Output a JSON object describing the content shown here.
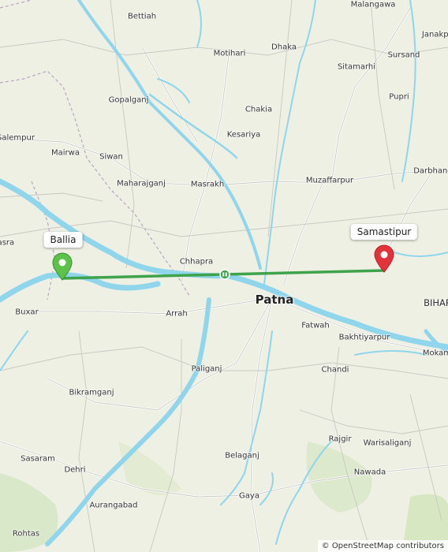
{
  "route": {
    "color": "#3ea34b",
    "from_label": "Ballia",
    "to_label": "Samastipur"
  },
  "markers": {
    "start": {
      "name": "Ballia",
      "color": "#5cc24a"
    },
    "end": {
      "name": "Samastipur",
      "color": "#e2323a"
    }
  },
  "places": [
    {
      "name": "Malangawa",
      "cls": ""
    },
    {
      "name": "Bettiah",
      "cls": ""
    },
    {
      "name": "Janakpur",
      "cls": ""
    },
    {
      "name": "Dhaka",
      "cls": ""
    },
    {
      "name": "Motihari",
      "cls": ""
    },
    {
      "name": "Sursand",
      "cls": ""
    },
    {
      "name": "Sitamarhi",
      "cls": ""
    },
    {
      "name": "Gopalganj",
      "cls": ""
    },
    {
      "name": "Pupri",
      "cls": ""
    },
    {
      "name": "Chakia",
      "cls": ""
    },
    {
      "name": "Salempur",
      "cls": ""
    },
    {
      "name": "Kesariya",
      "cls": ""
    },
    {
      "name": "Mairwa",
      "cls": ""
    },
    {
      "name": "Siwan",
      "cls": ""
    },
    {
      "name": "Darbhanga",
      "cls": ""
    },
    {
      "name": "Maharajganj",
      "cls": ""
    },
    {
      "name": "Masrakh",
      "cls": ""
    },
    {
      "name": "Muzaffarpur",
      "cls": ""
    },
    {
      "name": "Rasra",
      "cls": ""
    },
    {
      "name": "Chhapra",
      "cls": ""
    },
    {
      "name": "Patna",
      "cls": "big"
    },
    {
      "name": "BIHAR",
      "cls": "mid"
    },
    {
      "name": "Buxar",
      "cls": ""
    },
    {
      "name": "Arrah",
      "cls": ""
    },
    {
      "name": "Fatwah",
      "cls": ""
    },
    {
      "name": "Bakhtiyarpur",
      "cls": ""
    },
    {
      "name": "Mokama",
      "cls": ""
    },
    {
      "name": "Paliganj",
      "cls": ""
    },
    {
      "name": "Chandi",
      "cls": ""
    },
    {
      "name": "Bikramganj",
      "cls": ""
    },
    {
      "name": "Rajgir",
      "cls": ""
    },
    {
      "name": "Warisaliganj",
      "cls": ""
    },
    {
      "name": "Sasaram",
      "cls": ""
    },
    {
      "name": "Dehri",
      "cls": ""
    },
    {
      "name": "Belaganj",
      "cls": ""
    },
    {
      "name": "Nawada",
      "cls": ""
    },
    {
      "name": "Gaya",
      "cls": ""
    },
    {
      "name": "Aurangabad",
      "cls": ""
    },
    {
      "name": "Rohtas",
      "cls": ""
    }
  ],
  "attribution": {
    "symbol": "©",
    "text": "OpenStreetMap contributors"
  }
}
